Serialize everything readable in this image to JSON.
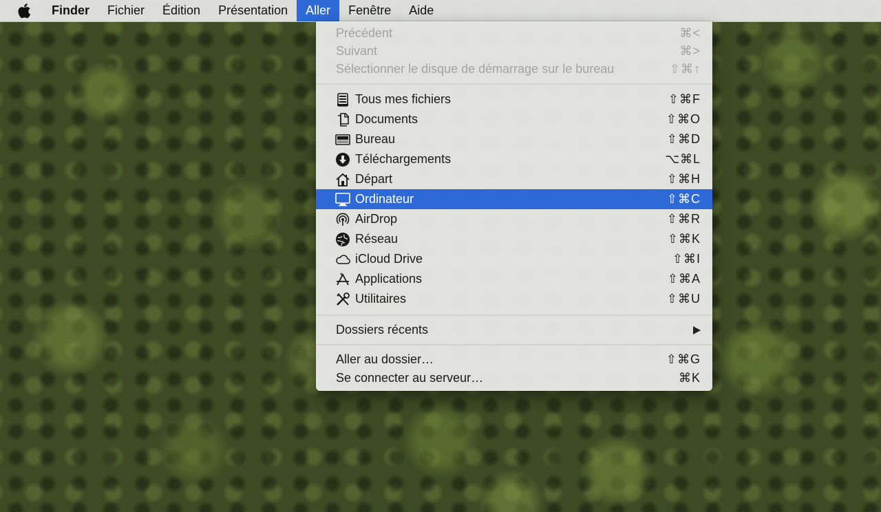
{
  "menubar": {
    "apple_icon": "apple-logo-icon",
    "items": [
      "Finder",
      "Fichier",
      "Édition",
      "Présentation",
      "Aller",
      "Fenêtre",
      "Aide"
    ],
    "active_item": "Aller",
    "selected_color": "#2d6ad8"
  },
  "go_menu": {
    "history": [
      {
        "label": "Précédent",
        "shortcut": "⌘<",
        "enabled": false
      },
      {
        "label": "Suivant",
        "shortcut": "⌘>",
        "enabled": false
      },
      {
        "label": "Sélectionner le disque de démarrage sur le bureau",
        "shortcut": "⇧⌘↑",
        "enabled": false
      }
    ],
    "places": [
      {
        "label": "Tous mes fichiers",
        "shortcut": "⇧⌘F",
        "icon": "all-files-icon"
      },
      {
        "label": "Documents",
        "shortcut": "⇧⌘O",
        "icon": "documents-icon"
      },
      {
        "label": "Bureau",
        "shortcut": "⇧⌘D",
        "icon": "desktop-icon"
      },
      {
        "label": "Téléchargements",
        "shortcut": "⌥⌘L",
        "icon": "downloads-icon"
      },
      {
        "label": "Départ",
        "shortcut": "⇧⌘H",
        "icon": "home-icon"
      },
      {
        "label": "Ordinateur",
        "shortcut": "⇧⌘C",
        "icon": "computer-icon",
        "selected": true
      },
      {
        "label": "AirDrop",
        "shortcut": "⇧⌘R",
        "icon": "airdrop-icon"
      },
      {
        "label": "Réseau",
        "shortcut": "⇧⌘K",
        "icon": "network-icon"
      },
      {
        "label": "iCloud Drive",
        "shortcut": "⇧⌘I",
        "icon": "icloud-icon"
      },
      {
        "label": "Applications",
        "shortcut": "⇧⌘A",
        "icon": "applications-icon"
      },
      {
        "label": "Utilitaires",
        "shortcut": "⇧⌘U",
        "icon": "utilities-icon"
      }
    ],
    "recent": {
      "label": "Dossiers récents",
      "submenu_icon": "submenu-arrow-icon"
    },
    "server": [
      {
        "label": "Aller au dossier…",
        "shortcut": "⇧⌘G"
      },
      {
        "label": "Se connecter au serveur…",
        "shortcut": "⌘K"
      }
    ]
  }
}
